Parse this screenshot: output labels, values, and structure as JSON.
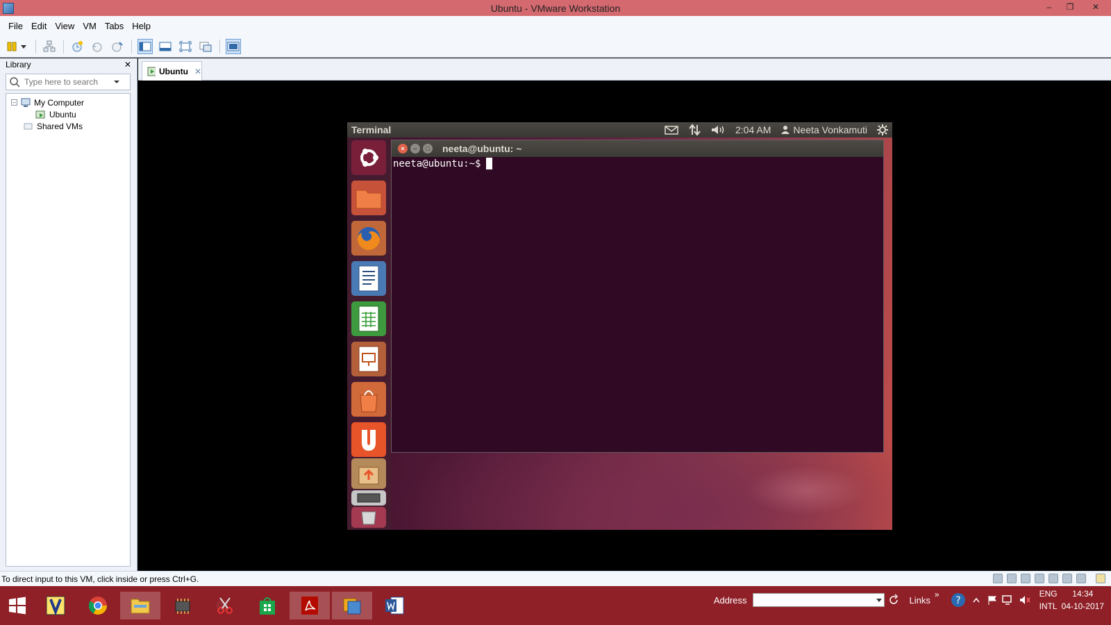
{
  "window": {
    "title": "Ubuntu - VMware Workstation",
    "minimize": "–",
    "restore": "❐",
    "close": "✕"
  },
  "menu": [
    "File",
    "Edit",
    "View",
    "VM",
    "Tabs",
    "Help"
  ],
  "library": {
    "title": "Library",
    "close": "✕",
    "search_placeholder": "Type here to search",
    "tree": {
      "root": "My Computer",
      "toggle": "–",
      "child": "Ubuntu",
      "shared": "Shared VMs"
    }
  },
  "tab": {
    "label": "Ubuntu",
    "close": "✕"
  },
  "guest": {
    "panel": {
      "title": "Terminal",
      "time": "2:04 AM",
      "user": "Neeta Vonkamuti"
    },
    "terminal": {
      "title": "neeta@ubuntu: ~",
      "close": "×",
      "minimize": "–",
      "maximize": "□",
      "prompt": "neeta@ubuntu:~$"
    },
    "launcher_items": [
      "ubuntu-dash",
      "files",
      "firefox",
      "libreoffice-writer",
      "libreoffice-calc",
      "libreoffice-impress",
      "ubuntu-software-center",
      "ubuntu-one",
      "update-manager",
      "workspace-switcher",
      "trash"
    ]
  },
  "status": {
    "message": "To direct input to this VM, click inside or press Ctrl+G."
  },
  "taskbar": {
    "apps": [
      "vlc",
      "chrome",
      "file-explorer",
      "chip-app",
      "snipping-tool",
      "store",
      "acrobat",
      "vmware",
      "word"
    ],
    "address_label": "Address",
    "links_label": "Links",
    "chevron": "»",
    "lang": "ENG",
    "layout": "INTL",
    "time": "14:34",
    "date": "04-10-2017"
  },
  "colors": {
    "titlebar": "#d46a70",
    "taskbar": "#8f2027",
    "terminal_bg": "#300a24"
  }
}
